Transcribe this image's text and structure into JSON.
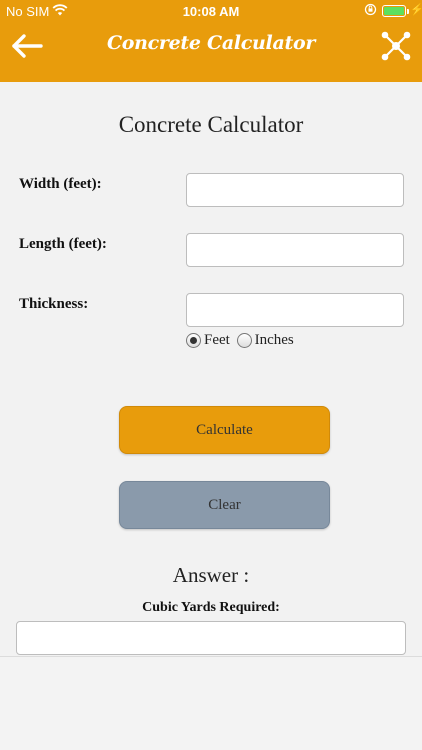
{
  "status_bar": {
    "carrier": "No SIM",
    "time": "10:08 AM",
    "battery_color": "#5ee05e"
  },
  "header": {
    "title": "Concrete Calculator",
    "back_icon": "arrow-left-icon",
    "share_icon": "share-nodes-icon",
    "color": "#e89c0c"
  },
  "form": {
    "title": "Concrete Calculator",
    "width_label": "Width (feet):",
    "length_label": "Length (feet):",
    "thickness_label": "Thickness:",
    "width_value": "",
    "length_value": "",
    "thickness_value": "",
    "unit_options": [
      "Feet",
      "Inches"
    ],
    "unit_selected": "Feet"
  },
  "buttons": {
    "calculate_label": "Calculate",
    "clear_label": "Clear",
    "calculate_color": "#e89c0c",
    "clear_color": "#8a9aab"
  },
  "answer": {
    "title": "Answer :",
    "subtitle": "Cubic Yards Required:",
    "value": ""
  }
}
